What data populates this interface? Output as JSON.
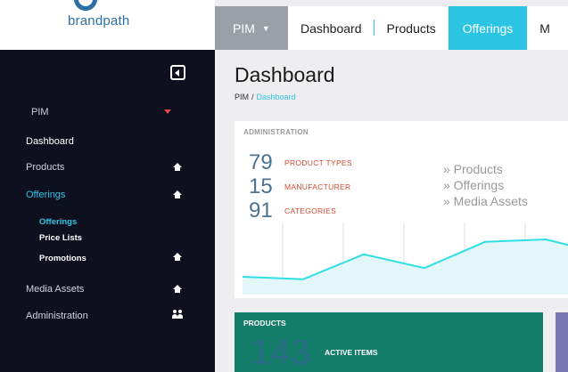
{
  "brand": {
    "name": "brandpath"
  },
  "topnav": {
    "pim_label": "PIM",
    "items": [
      {
        "label": "Dashboard"
      },
      {
        "label": "Products"
      },
      {
        "label": "Offerings"
      },
      {
        "label": "M"
      }
    ],
    "active": "Offerings"
  },
  "sidebar": {
    "section": "PIM",
    "items": [
      {
        "label": "Dashboard"
      },
      {
        "label": "Products",
        "icon": "home-icon"
      },
      {
        "label": "Offerings",
        "icon": "home-icon"
      },
      {
        "label": "Media Assets",
        "icon": "home-icon"
      },
      {
        "label": "Administration",
        "icon": "users-icon"
      }
    ],
    "subitems": [
      {
        "label": "Offerings"
      },
      {
        "label": "Price Lists"
      },
      {
        "label": "Promotions",
        "icon": "home-icon"
      }
    ]
  },
  "page": {
    "title": "Dashboard",
    "breadcrumb": {
      "root": "PIM",
      "separator": "/",
      "current": "Dashboard"
    }
  },
  "admin_panel": {
    "label": "ADMINISTRATION",
    "stats": [
      {
        "value": "79",
        "label": "PRODUCT TYPES"
      },
      {
        "value": "15",
        "label": "MANUFACTURER"
      },
      {
        "value": "91",
        "label": "CATEGORIES"
      }
    ],
    "links": [
      "» Products",
      "» Offerings",
      "» Media Assets"
    ]
  },
  "products_panel": {
    "title": "PRODUCTS",
    "value": "143",
    "label": "ACTIVE ITEMS"
  },
  "colors": {
    "accent": "#2bc4e3",
    "sidebar": "#0e1020",
    "products": "#137d6a",
    "stat_label": "#d04a30"
  },
  "chart_data": {
    "type": "area",
    "x": [
      0,
      1,
      2,
      3,
      4,
      5,
      6
    ],
    "values": [
      10,
      8,
      28,
      17,
      38,
      40,
      28
    ],
    "ylim": [
      0,
      50
    ],
    "grid": true
  }
}
